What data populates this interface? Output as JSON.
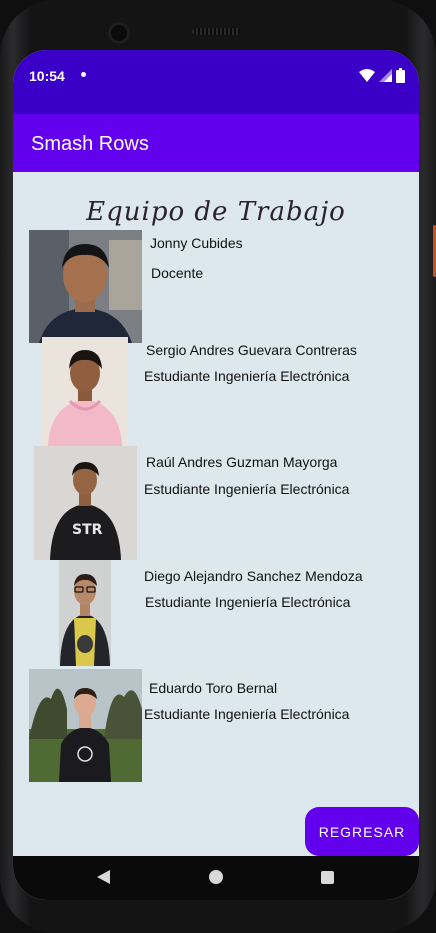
{
  "status_bar": {
    "time": "10:54"
  },
  "app_bar": {
    "title": "Smash Rows"
  },
  "heading": "Equipo de Trabajo",
  "members": [
    {
      "name": "Jonny Cubides",
      "role": "Docente"
    },
    {
      "name": "Sergio Andres Guevara Contreras",
      "role": "Estudiante Ingeniería Electrónica"
    },
    {
      "name": "Raúl Andres Guzman Mayorga",
      "role": "Estudiante Ingeniería Electrónica"
    },
    {
      "name": "Diego Alejandro Sanchez Mendoza",
      "role": "Estudiante Ingeniería Electrónica"
    },
    {
      "name": "Eduardo Toro Bernal",
      "role": "Estudiante Ingeniería Electrónica"
    }
  ],
  "back_button": {
    "label": "REGRESAR"
  },
  "colors": {
    "status_bar": "#3a00c8",
    "app_bar": "#6200ee",
    "background": "#dde8ee",
    "button": "#6200ee"
  },
  "icons": {
    "status": [
      "wifi-icon",
      "signal-icon",
      "battery-icon"
    ],
    "nav": [
      "back-icon",
      "home-icon",
      "recents-icon"
    ]
  }
}
